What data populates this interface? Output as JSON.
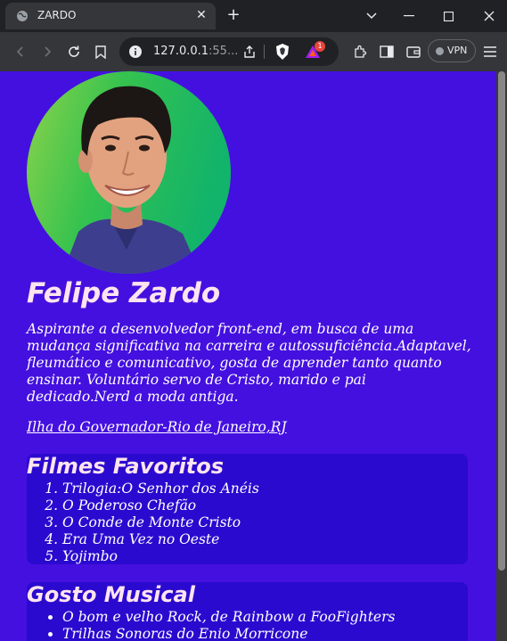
{
  "browser": {
    "tab_title": "ZARDO",
    "url_main": "127.0.0.1",
    "url_dim": ":55...",
    "vpn_label": "VPN",
    "notification_count": "1"
  },
  "profile": {
    "name": "Felipe Zardo",
    "bio": "Aspirante a desenvolvedor front-end, em busca de uma mudança significativa na carreira e autossuficiência.Adaptavel, fleumático e comunicativo, gosta de aprender tanto quanto ensinar. Voluntário servo de Cristo, marido e pai dedicado.Nerd a moda antiga.",
    "location": "Ilha do Governador-Rio de Janeiro,RJ"
  },
  "movies": {
    "title": "Filmes Favoritos",
    "items": [
      "Trilogia:O Senhor dos Anéis",
      "O Poderoso Chefão",
      "O Conde de Monte Cristo",
      "Era Uma Vez no Oeste",
      "Yojimbo"
    ]
  },
  "music": {
    "title": "Gosto Musical",
    "items": [
      "O bom e velho Rock, de Rainbow a FooFighters",
      "Trilhas Sonoras do Enio Morricone"
    ]
  },
  "colors": {
    "page_background": "#4410df",
    "card_background": "#2b0acf",
    "heading": "#ffe4ef"
  }
}
